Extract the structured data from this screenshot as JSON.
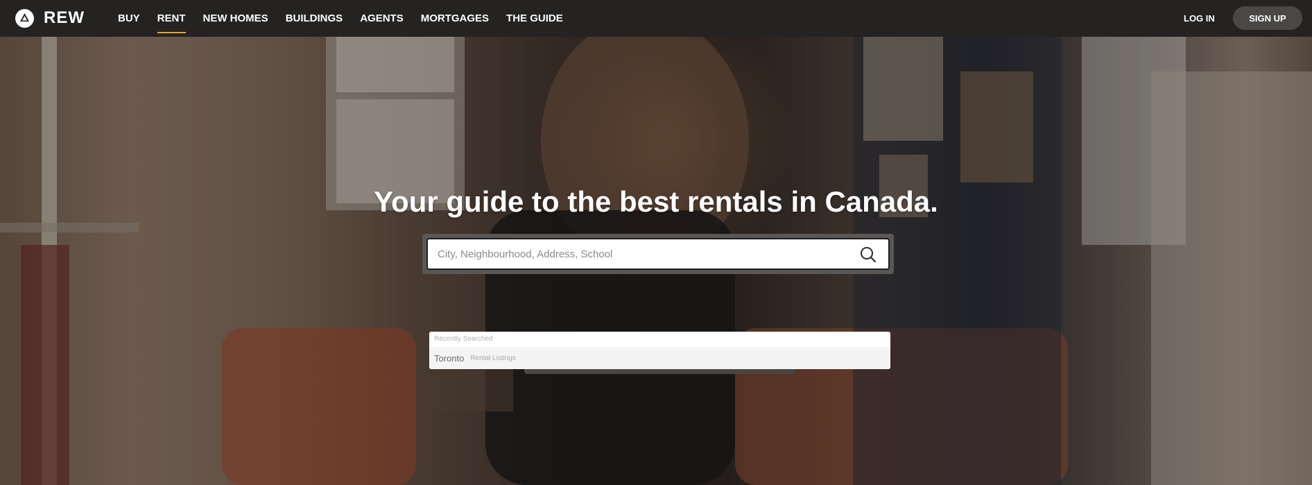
{
  "brand": {
    "name": "REW"
  },
  "nav": {
    "items": [
      {
        "label": "BUY",
        "active": false
      },
      {
        "label": "RENT",
        "active": true
      },
      {
        "label": "NEW HOMES",
        "active": false
      },
      {
        "label": "BUILDINGS",
        "active": false
      },
      {
        "label": "AGENTS",
        "active": false
      },
      {
        "label": "MORTGAGES",
        "active": false
      },
      {
        "label": "THE GUIDE",
        "active": false
      }
    ],
    "login_label": "LOG IN",
    "signup_label": "SIGN UP",
    "active_color": "#e8a531"
  },
  "hero": {
    "title": "Your guide to the best rentals in Canada."
  },
  "search": {
    "placeholder": "City, Neighbourhood, Address, School",
    "value": "",
    "icon": "search-icon"
  },
  "suggestions": {
    "heading": "Recently Searched",
    "items": [
      {
        "city": "Toronto",
        "type": "Rental Listings"
      }
    ]
  }
}
